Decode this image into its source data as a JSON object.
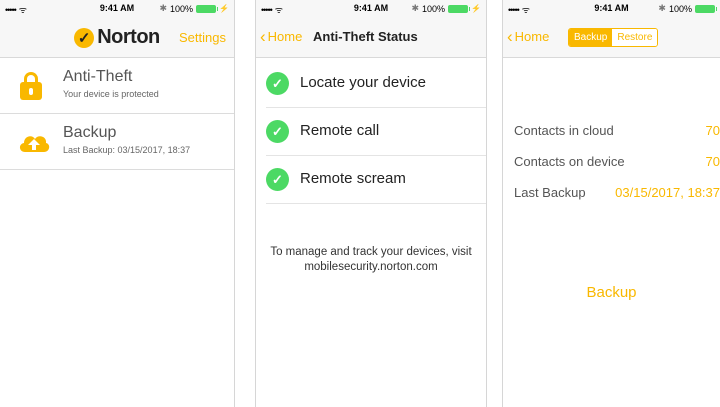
{
  "status_bar": {
    "signal": "•••••",
    "wifi": "ᯤ",
    "time": "9:41 AM",
    "bluetooth": "✱",
    "battery": "100%",
    "charging": "⚡",
    "battery_color": "#4cd964"
  },
  "colors": {
    "accent": "#f9b800",
    "check": "#4cd964"
  },
  "screen1": {
    "brand": "Norton",
    "brand_icon": "checkmark-logo-icon",
    "settings_label": "Settings",
    "items": [
      {
        "title": "Anti-Theft",
        "subtitle": "Your device is protected",
        "icon": "lock-icon"
      },
      {
        "title": "Backup",
        "subtitle": "Last Backup: 03/15/2017, 18:37",
        "icon": "cloud-upload-icon"
      }
    ]
  },
  "screen2": {
    "back_label": "Home",
    "title": "Anti-Theft Status",
    "features": [
      {
        "label": "Locate your device",
        "icon": "check-circle-icon"
      },
      {
        "label": "Remote call",
        "icon": "check-circle-icon"
      },
      {
        "label": "Remote scream",
        "icon": "check-circle-icon"
      }
    ],
    "info": "To manage and track your devices, visit mobilesecurity.norton.com"
  },
  "screen3": {
    "back_label": "Home",
    "segments": [
      "Backup",
      "Restore"
    ],
    "active_segment": "Backup",
    "rows": [
      {
        "label": "Contacts in cloud",
        "value": "70"
      },
      {
        "label": "Contacts on device",
        "value": "70"
      },
      {
        "label": "Last Backup",
        "value": "03/15/2017, 18:37"
      }
    ],
    "action": "Backup"
  }
}
